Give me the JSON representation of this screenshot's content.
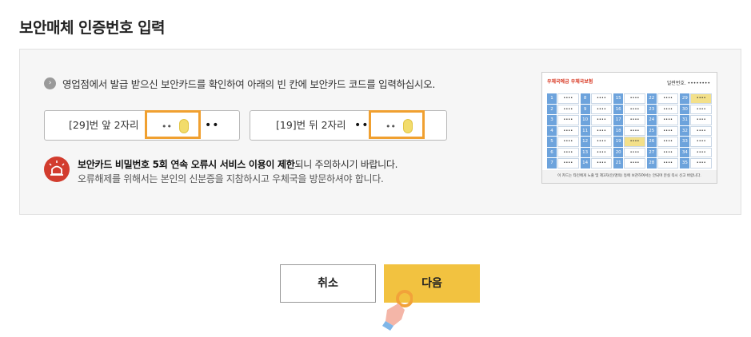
{
  "page": {
    "title": "보안매체 인증번호 입력"
  },
  "guide": {
    "bullet": "›",
    "text": "영업점에서 발급 받으신 보안카드를 확인하여 아래의 빈 칸에 보안카드 코드를 입력하십시오."
  },
  "code_inputs": [
    {
      "label": "[29]번 앞 2자리",
      "entered": "••",
      "fixed": "••"
    },
    {
      "label": "[19]번 뒤 2자리",
      "fixed": "••",
      "entered": "••"
    }
  ],
  "warning": {
    "bold": "보안카드 비밀번호 5회 연속 오류시 서비스 이용이 제한",
    "rest": "되니 주의하시기 바랍니다.",
    "line2": "오류해제를 위해서는 본인의 신분증을 지참하시고 우체국을 방문하셔야 합니다."
  },
  "card": {
    "logo": "우체국예금 우체국보험",
    "serial": "일련번호. ••••••••",
    "footer": "이 카드는 타인에게 노출 및 제3자(인/명의) 등에 보관하여서는 안되며 분실 즉시 신고 바랍니다.",
    "columns": [
      [
        "1",
        "2",
        "3",
        "4",
        "5",
        "6",
        "7"
      ],
      [
        "8",
        "9",
        "10",
        "11",
        "12",
        "13",
        "14"
      ],
      [
        "15",
        "16",
        "17",
        "18",
        "19",
        "20",
        "21"
      ],
      [
        "22",
        "23",
        "24",
        "25",
        "26",
        "27",
        "28"
      ],
      [
        "29",
        "30",
        "31",
        "32",
        "33",
        "34",
        "35"
      ]
    ],
    "value_mask": "••••",
    "highlighted": [
      "29",
      "19"
    ]
  },
  "buttons": {
    "cancel": "취소",
    "next": "다음"
  },
  "colors": {
    "accent": "#f2c240",
    "input_highlight": "#f0a030",
    "card_blue": "#6da3dc",
    "warning_red": "#d23c2e"
  }
}
